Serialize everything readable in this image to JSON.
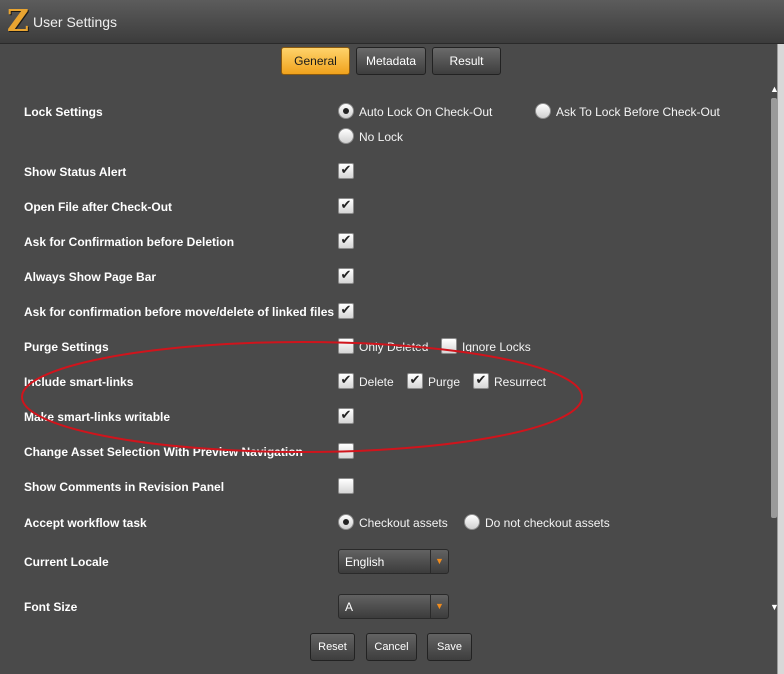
{
  "window": {
    "title": "User Settings",
    "logo_letter": "Z"
  },
  "tabs": [
    {
      "label": "General",
      "active": true
    },
    {
      "label": "Metadata",
      "active": false
    },
    {
      "label": "Result",
      "active": false
    }
  ],
  "settings": {
    "lock": {
      "label": "Lock Settings",
      "options": [
        {
          "label": "Auto Lock On Check-Out",
          "selected": true
        },
        {
          "label": "Ask To Lock Before Check-Out",
          "selected": false
        },
        {
          "label": "No Lock",
          "selected": false
        }
      ]
    },
    "show_status_alert": {
      "label": "Show Status Alert",
      "checked": true
    },
    "open_file_after_checkout": {
      "label": "Open File after Check-Out",
      "checked": true
    },
    "confirm_before_deletion": {
      "label": "Ask for Confirmation before Deletion",
      "checked": true
    },
    "always_show_page_bar": {
      "label": "Always Show Page Bar",
      "checked": true
    },
    "confirm_move_delete_linked": {
      "label": "Ask for confirmation before move/delete of linked files",
      "checked": true
    },
    "purge": {
      "label": "Purge Settings",
      "options": [
        {
          "label": "Only Deleted",
          "checked": false
        },
        {
          "label": "Ignore Locks",
          "checked": false
        }
      ]
    },
    "include_smart_links": {
      "label": "Include smart-links",
      "options": [
        {
          "label": "Delete",
          "checked": true
        },
        {
          "label": "Purge",
          "checked": true
        },
        {
          "label": "Resurrect",
          "checked": true
        }
      ]
    },
    "smart_links_writable": {
      "label": "Make smart-links writable",
      "checked": true
    },
    "change_asset_selection_preview": {
      "label": "Change Asset Selection With Preview Navigation",
      "checked": false
    },
    "show_comments_revision": {
      "label": "Show Comments in Revision Panel",
      "checked": false
    },
    "workflow_task": {
      "label": "Accept workflow task",
      "options": [
        {
          "label": "Checkout assets",
          "selected": true
        },
        {
          "label": "Do not checkout assets",
          "selected": false
        }
      ]
    },
    "current_locale": {
      "label": "Current Locale",
      "value": "English"
    },
    "font_size": {
      "label": "Font Size",
      "value": "A"
    }
  },
  "footer": {
    "reset_label": "Reset",
    "cancel_label": "Cancel",
    "save_label": "Save"
  },
  "icons": {
    "scroll_up": "triangle-up",
    "scroll_down": "triangle-down",
    "dropdown": "chevron-down"
  },
  "colors": {
    "accent": "#f0a21c",
    "annotation": "#d0141c",
    "dropdown_arrow": "#f08c1e"
  }
}
